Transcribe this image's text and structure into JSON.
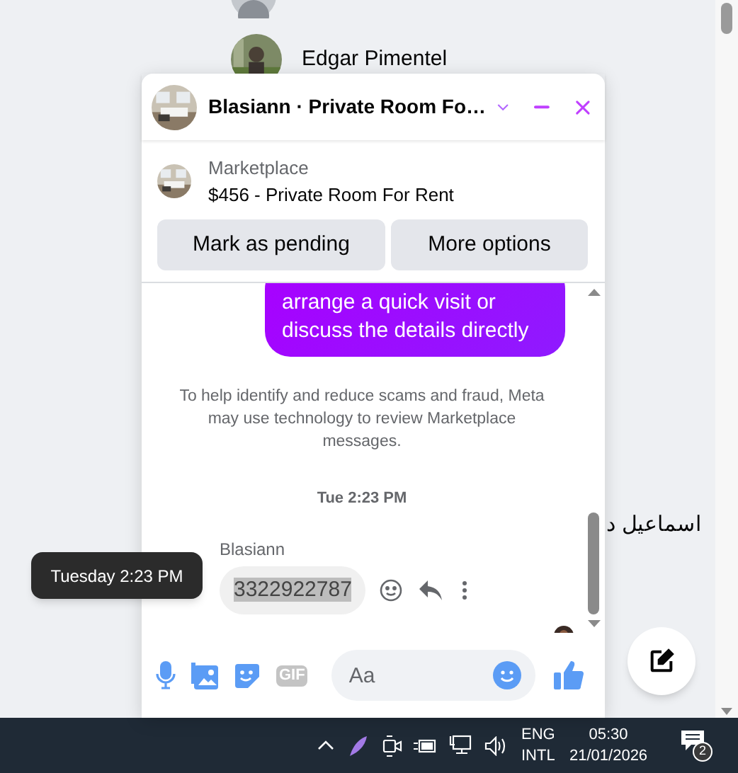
{
  "contacts": [
    {
      "name": "Edgar Pimentel"
    },
    {
      "name": "اسماعيل د"
    }
  ],
  "chat": {
    "title": "Blasiann · Private Room Fo…",
    "listing": {
      "source": "Marketplace",
      "item": "$456 - Private Room For Rent"
    },
    "actions": [
      "Mark as pending",
      "More options"
    ],
    "messages": [
      {
        "kind": "outgoing",
        "text": "arrange a quick visit or discuss the details directly"
      },
      {
        "kind": "notice",
        "text": "To help identify and reduce scams and fraud, Meta may use technology to review Marketplace messages."
      },
      {
        "kind": "timestamp",
        "text": "Tue 2:23 PM"
      },
      {
        "kind": "incoming",
        "sender": "Blasiann",
        "text": "3322922787",
        "selected": true
      }
    ],
    "tooltip": "Tuesday 2:23 PM",
    "composer": {
      "gif_label": "GIF",
      "placeholder": "Aa"
    }
  },
  "taskbar": {
    "language": [
      "ENG",
      "INTL"
    ],
    "time": "05:30",
    "date": "21/01/2026",
    "notifications": "2"
  }
}
